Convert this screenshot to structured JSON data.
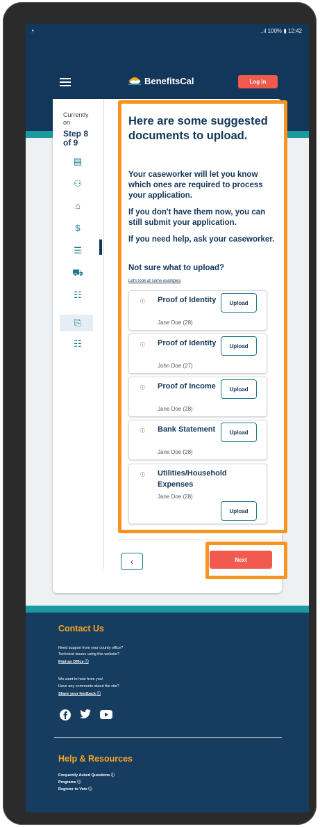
{
  "status_bar": {
    "left_icon": "◔",
    "signal": "..ıl 100% ▮ 12:42"
  },
  "header": {
    "logo_text": "BenefitsCal",
    "login_label": "Log In"
  },
  "steps": {
    "currently_label": "Currently on",
    "step_label": "Step 8 of 9"
  },
  "docs": {
    "heading": "Here are some suggested documents to upload.",
    "para1": "Your caseworker will let you know which ones are required to process your application.",
    "para2": "If you don't have them now, you can still submit your application.",
    "para3": "If you need help, ask your caseworker.",
    "question": "Not sure what to upload?",
    "examples_link": "Let's look at some examples",
    "items": [
      {
        "title": "Proof of Identity",
        "person": "Jane Doe (28)",
        "button": "Upload"
      },
      {
        "title": "Proof of Identity",
        "person": "John Doe (27)",
        "button": "Upload"
      },
      {
        "title": "Proof of Income",
        "person": "Jane Doe (28)",
        "button": "Upload"
      },
      {
        "title": "Bank Statement",
        "person": "Jane Doe (28)",
        "button": "Upload"
      },
      {
        "title": "Utilities/Household Expenses",
        "person": "Jane Doe (28)",
        "button": "Upload"
      }
    ]
  },
  "nav": {
    "back": "‹",
    "next": "Next"
  },
  "footer": {
    "contact_heading": "Contact Us",
    "line1": "Need support from your county office?",
    "line2": "Technical issues using this website?",
    "find_office": "Find an Office",
    "line3": "We want to hear from you!",
    "line4": "Have any comments about the site?",
    "feedback": "Share your feedback",
    "help_heading": "Help & Resources",
    "faq": "Frequently Asked Questions",
    "programs": "Programs",
    "vote": "Register to Vote"
  },
  "colors": {
    "navy": "#13375a",
    "teal": "#1a9aa0",
    "accent": "#f05a4f",
    "highlight": "#f7941d",
    "gold": "#f6a623"
  }
}
